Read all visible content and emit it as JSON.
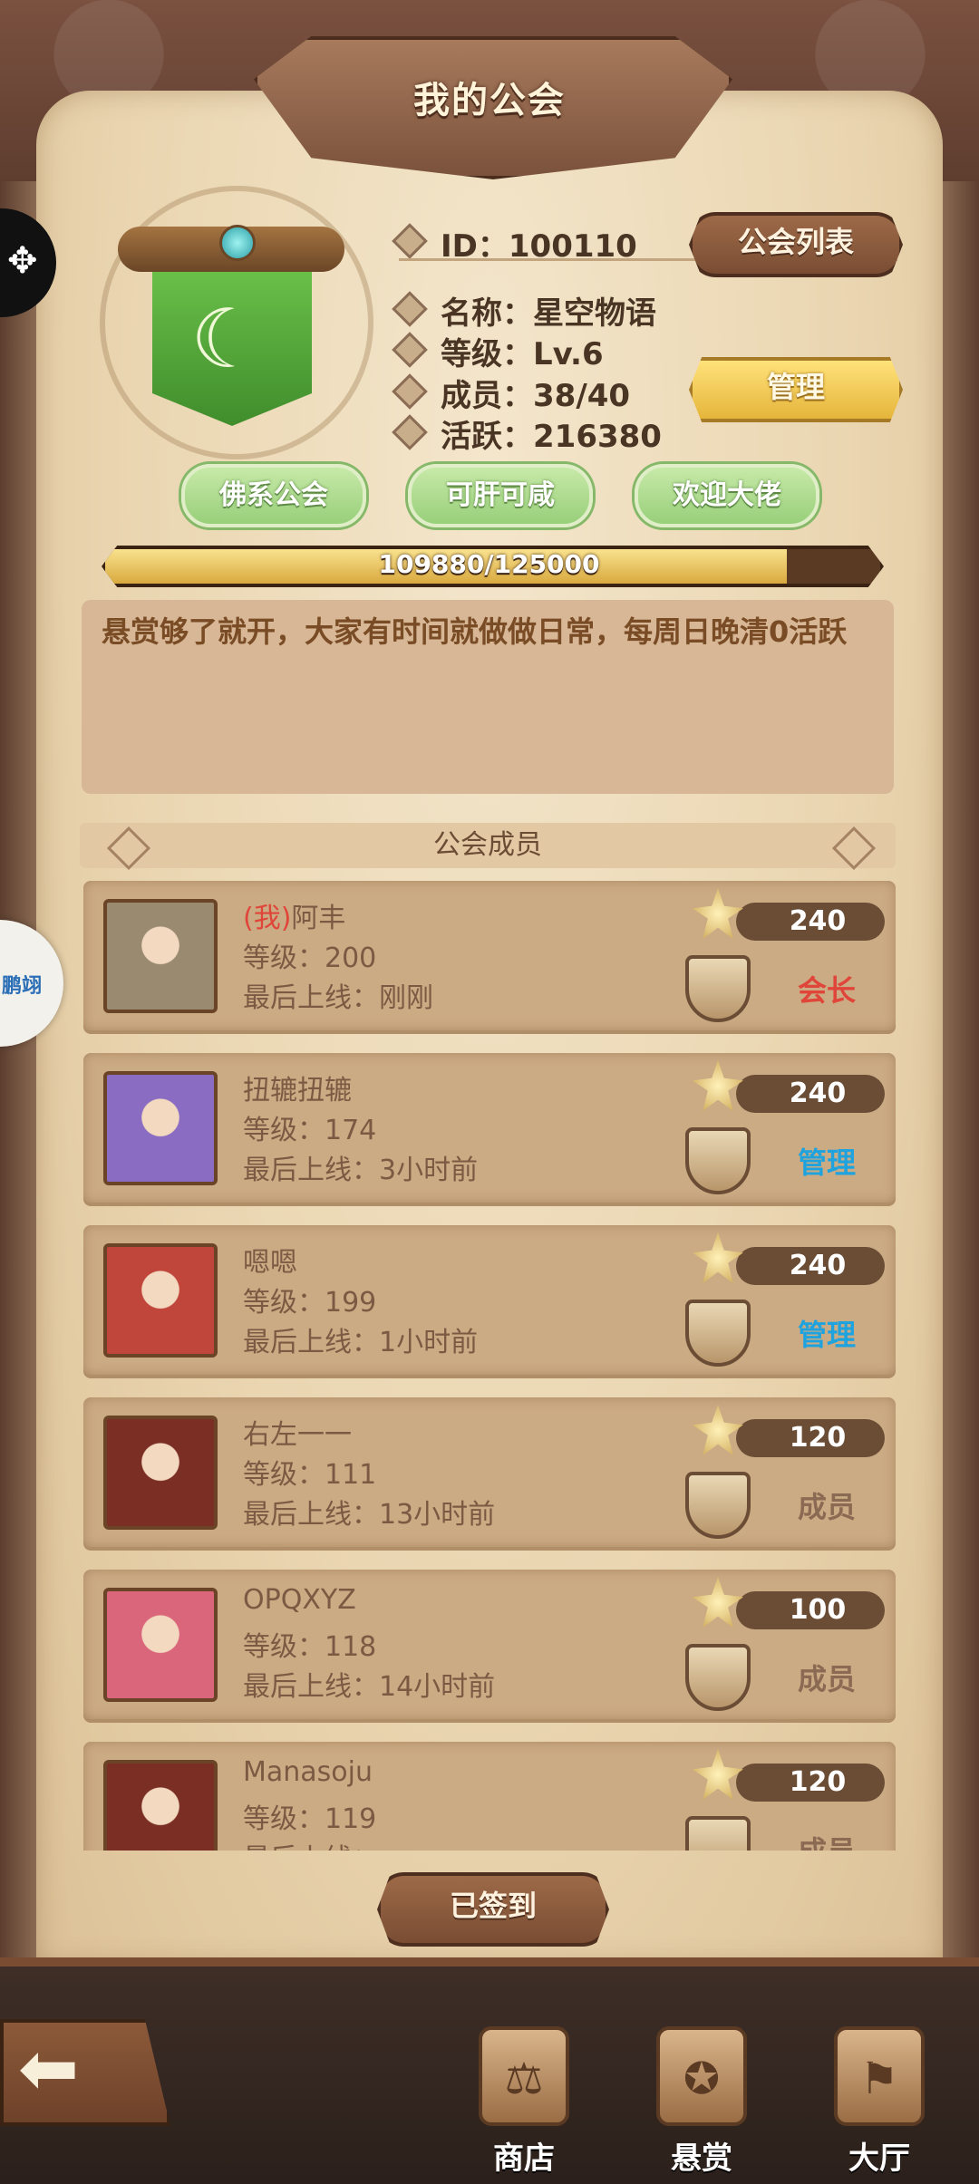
{
  "header": {
    "title": "我的公会"
  },
  "guild": {
    "id_label": "ID：",
    "id_value": "100110",
    "name_label": "名称：",
    "name_value": "星空物语",
    "level_label": "等级：",
    "level_value": "Lv.6",
    "members_label": "成员：",
    "members_value": "38/40",
    "activity_label": "活跃：",
    "activity_value": "216380",
    "tags": [
      "佛系公会",
      "可肝可咸",
      "欢迎大佬"
    ],
    "exp_text": "109880/125000",
    "exp_fraction": 0.879,
    "notice": "悬赏够了就开，大家有时间就做做日常，每周日晚清0活跃"
  },
  "buttons": {
    "guild_list": "公会列表",
    "manage": "管理",
    "signed_in": "已签到"
  },
  "members_section": {
    "title": "公会成员"
  },
  "members": [
    {
      "me_tag": "(我)",
      "name": "阿丰",
      "level": "等级：200",
      "last_online": "最后上线：刚刚",
      "score": "240",
      "role": "会长",
      "role_color": "#e0453a",
      "avatar_color": "#9a8a70"
    },
    {
      "me_tag": "",
      "name": "扭辘扭辘",
      "level": "等级：174",
      "last_online": "最后上线：3小时前",
      "score": "240",
      "role": "管理",
      "role_color": "#1ea3df",
      "avatar_color": "#8a6cc2"
    },
    {
      "me_tag": "",
      "name": "嗯嗯",
      "level": "等级：199",
      "last_online": "最后上线：1小时前",
      "score": "240",
      "role": "管理",
      "role_color": "#1ea3df",
      "avatar_color": "#c0463c"
    },
    {
      "me_tag": "",
      "name": "右左一一",
      "level": "等级：111",
      "last_online": "最后上线：13小时前",
      "score": "120",
      "role": "成员",
      "role_color": "#8a6a52",
      "avatar_color": "#7a2e24"
    },
    {
      "me_tag": "",
      "name": "OPQXYZ",
      "level": "等级：118",
      "last_online": "最后上线：14小时前",
      "score": "100",
      "role": "成员",
      "role_color": "#8a6a52",
      "avatar_color": "#d9667a"
    },
    {
      "me_tag": "",
      "name": "Manasoju",
      "level": "等级：119",
      "last_online": "最后上线：",
      "score": "120",
      "role": "成员",
      "role_color": "#8a6a52",
      "avatar_color": "#7a2e24"
    }
  ],
  "bottom_nav": [
    {
      "label": "商店",
      "icon": "shop-icon",
      "glyph": "⚖"
    },
    {
      "label": "悬赏",
      "icon": "bounty-icon",
      "glyph": "✪"
    },
    {
      "label": "大厅",
      "icon": "hall-icon",
      "glyph": "⚑"
    }
  ],
  "edge": {
    "float_ball_text": "鹏翊"
  }
}
